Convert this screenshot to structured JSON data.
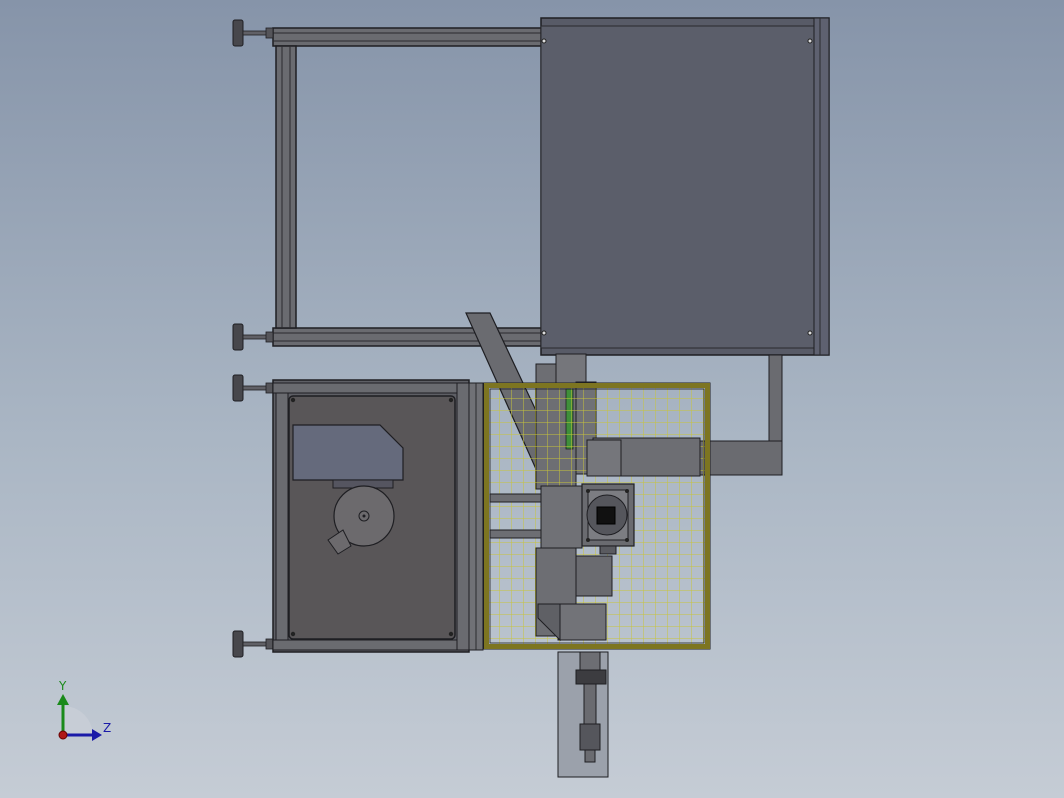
{
  "viewport": {
    "background_top": "#8694a9",
    "background_bottom": "#c5ccd5"
  },
  "model_colors": {
    "frame": "#5a5b61",
    "panel": "#585b67",
    "guard_frame": "#7d7521",
    "guard_mesh": "#c8c43a",
    "edge": "#1e1e22"
  },
  "triad": {
    "y_label": "Y",
    "z_label": "Z",
    "y_color": "#1a8a1a",
    "z_color": "#1a1aa8",
    "origin_color": "#b01818"
  }
}
